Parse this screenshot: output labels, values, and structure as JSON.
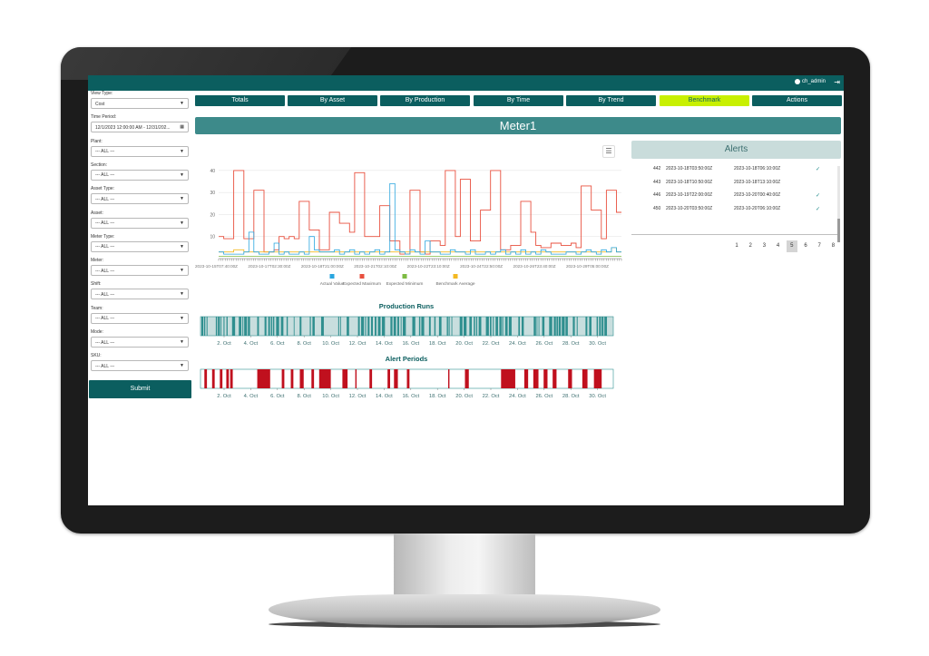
{
  "topbar": {
    "user": "ch_admin",
    "logout_icon": "logout-icon"
  },
  "filters": [
    {
      "label": "View Type:",
      "value": "Cost"
    },
    {
      "label": "Time Period:",
      "value": "12/1/2023 12:00:00 AM - 12/31/202...",
      "icon": "calendar-icon"
    },
    {
      "label": "Plant:",
      "value": "--- ALL ---"
    },
    {
      "label": "Section:",
      "value": "--- ALL ---"
    },
    {
      "label": "Asset Type:",
      "value": "--- ALL ---"
    },
    {
      "label": "Asset:",
      "value": "--- ALL ---"
    },
    {
      "label": "Meter Type:",
      "value": "--- ALL ---"
    },
    {
      "label": "Meter:",
      "value": "--- ALL ---"
    },
    {
      "label": "Shift:",
      "value": "--- ALL ---"
    },
    {
      "label": "Team:",
      "value": "--- ALL ---"
    },
    {
      "label": "Mode:",
      "value": "--- ALL ---"
    },
    {
      "label": "SKU:",
      "value": "--- ALL ---"
    }
  ],
  "submit_label": "Submit",
  "tabs": [
    {
      "label": "Totals",
      "active": false
    },
    {
      "label": "By Asset",
      "active": false
    },
    {
      "label": "By Production",
      "active": false
    },
    {
      "label": "By Time",
      "active": false
    },
    {
      "label": "By Trend",
      "active": false
    },
    {
      "label": "Benchmark",
      "active": true
    },
    {
      "label": "Actions",
      "active": false
    }
  ],
  "meter_title": "Meter1",
  "alerts": {
    "title": "Alerts",
    "rows": [
      {
        "id": "442",
        "start": "2023-10-18T03:50:00Z",
        "end": "2023-10-18T06:10:00Z",
        "ack": true
      },
      {
        "id": "443",
        "start": "2023-10-18T10:50:00Z",
        "end": "2023-10-18T13:10:00Z",
        "ack": false
      },
      {
        "id": "446",
        "start": "2023-10-19T22:00:00Z",
        "end": "2023-10-20T00:40:00Z",
        "ack": true
      },
      {
        "id": "450",
        "start": "2023-10-20T03:50:00Z",
        "end": "2023-10-20T06:10:00Z",
        "ack": true
      }
    ],
    "pages": [
      "1",
      "2",
      "3",
      "4",
      "5",
      "6",
      "7",
      "8"
    ],
    "active_page": "5"
  },
  "chart_data": [
    {
      "type": "line",
      "y_ticks": [
        "10",
        "20",
        "30",
        "40"
      ],
      "ylim": [
        0,
        42
      ],
      "x_tick_labels": [
        "2023-10-15T07:40:00Z",
        "2023-10-17T02:30:00Z",
        "2023-10-18T21:00:00Z",
        "2023-10-21T02:10:00Z",
        "2023-10-22T23:10:00Z",
        "2023-10-24T22:50:00Z",
        "2023-10-26T23:40:00Z",
        "2023-10-29T05:00:00Z"
      ],
      "legend_position": "bottom",
      "colors": {
        "actual": "#2aa6df",
        "max": "#e8503f",
        "min": "#7dbb43",
        "bench": "#f3b821"
      },
      "series": [
        {
          "name": "Actual Value",
          "values": [
            3,
            2,
            2,
            2,
            2,
            3,
            12,
            3,
            2,
            2,
            3,
            7,
            2,
            3,
            2,
            2,
            3,
            2,
            10,
            4,
            3,
            3,
            3,
            4,
            2,
            3,
            4,
            2,
            3,
            2,
            3,
            4,
            2,
            3,
            34,
            4,
            3,
            2,
            4,
            3,
            2,
            8,
            3,
            3,
            2,
            2,
            4,
            3,
            3,
            2,
            4,
            2,
            2,
            3,
            2,
            3,
            4,
            2,
            3,
            2,
            4,
            2,
            3,
            2,
            4,
            3,
            2,
            2,
            2,
            3,
            3,
            2,
            3,
            4,
            3,
            2,
            4,
            3,
            5,
            3
          ]
        },
        {
          "name": "Expected Maximum",
          "values": [
            10,
            9,
            9,
            40,
            40,
            9,
            9,
            31,
            31,
            3,
            3,
            4,
            10,
            9,
            10,
            9,
            26,
            26,
            13,
            13,
            4,
            4,
            21,
            21,
            16,
            16,
            12,
            39,
            39,
            10,
            10,
            10,
            24,
            24,
            8,
            8,
            2,
            2,
            31,
            31,
            3,
            2,
            8,
            8,
            6,
            40,
            40,
            10,
            36,
            36,
            8,
            8,
            22,
            22,
            40,
            40,
            4,
            4,
            6,
            6,
            26,
            26,
            12,
            6,
            5,
            5,
            7,
            7,
            6,
            6,
            7,
            5,
            33,
            33,
            22,
            22,
            9,
            31,
            31,
            21
          ]
        },
        {
          "name": "Expected Minimum",
          "values": [
            1,
            1,
            1,
            1,
            1,
            1,
            1,
            1,
            1,
            1,
            1,
            1,
            1,
            1,
            1,
            1,
            1,
            1,
            1,
            1,
            1,
            1,
            1,
            1,
            1,
            1,
            1,
            1,
            1,
            1,
            1,
            1,
            1,
            1,
            1,
            1,
            1,
            1,
            1,
            1,
            1,
            1,
            1,
            1,
            1,
            1,
            1,
            1,
            1,
            1,
            1,
            1,
            1,
            1,
            1,
            1,
            1,
            1,
            1,
            1,
            1,
            1,
            1,
            1,
            1,
            1,
            1,
            1,
            1,
            1,
            1,
            1,
            1,
            1,
            1,
            1,
            1,
            1,
            1,
            1
          ]
        },
        {
          "name": "Benchmark Average",
          "values": [
            3,
            3,
            3,
            4,
            4,
            3,
            3,
            3,
            3,
            3,
            3,
            3,
            3,
            3,
            3,
            3,
            3,
            3,
            3,
            3,
            3,
            3,
            3,
            3,
            3,
            3,
            3,
            3,
            3,
            3,
            3,
            3,
            3,
            3,
            3,
            3,
            3,
            3,
            3,
            3,
            3,
            3,
            3,
            3,
            3,
            3,
            3,
            3,
            3,
            3,
            3,
            3,
            3,
            3,
            3,
            3,
            3,
            3,
            3,
            3,
            3,
            3,
            3,
            3,
            3,
            3,
            3,
            3,
            3,
            3,
            3,
            3,
            3,
            3,
            3,
            3,
            3,
            3,
            5,
            3
          ]
        }
      ]
    },
    {
      "type": "timeline",
      "title": "Production Runs",
      "x_tick_labels": [
        "2. Oct",
        "4. Oct",
        "6. Oct",
        "8. Oct",
        "10. Oct",
        "12. Oct",
        "14. Oct",
        "16. Oct",
        "18. Oct",
        "20. Oct",
        "22. Oct",
        "24. Oct",
        "26. Oct",
        "28. Oct",
        "30. Oct"
      ],
      "colors": {
        "fill": "#2f8f8f",
        "background": "#c8dede"
      }
    },
    {
      "type": "timeline",
      "title": "Alert Periods",
      "x_tick_labels": [
        "2. Oct",
        "4. Oct",
        "6. Oct",
        "8. Oct",
        "10. Oct",
        "12. Oct",
        "14. Oct",
        "16. Oct",
        "18. Oct",
        "20. Oct",
        "22. Oct",
        "24. Oct",
        "26. Oct",
        "28. Oct",
        "30. Oct"
      ],
      "colors": {
        "fill": "#c0101e",
        "background": "#ffffff"
      },
      "periods": [
        [
          1.3,
          1.5
        ],
        [
          1.9,
          2.1
        ],
        [
          2.5,
          2.7
        ],
        [
          3.0,
          3.2
        ],
        [
          3.3,
          3.5
        ],
        [
          5.4,
          6.4
        ],
        [
          7.3,
          7.5
        ],
        [
          8.0,
          8.2
        ],
        [
          8.7,
          9.0
        ],
        [
          9.6,
          9.8
        ],
        [
          10.2,
          11.1
        ],
        [
          12.0,
          12.4
        ],
        [
          13.0,
          13.1
        ],
        [
          14.1,
          14.3
        ],
        [
          15.5,
          15.7
        ],
        [
          16.0,
          16.3
        ],
        [
          17.0,
          17.2
        ],
        [
          20.2,
          20.3
        ],
        [
          21.5,
          21.8
        ],
        [
          24.3,
          25.4
        ],
        [
          26.1,
          26.4
        ],
        [
          26.8,
          27.2
        ],
        [
          27.6,
          27.9
        ],
        [
          28.3,
          28.6
        ],
        [
          29.5,
          29.8
        ],
        [
          30.6,
          31.0
        ],
        [
          31.5,
          32.1
        ]
      ]
    }
  ]
}
